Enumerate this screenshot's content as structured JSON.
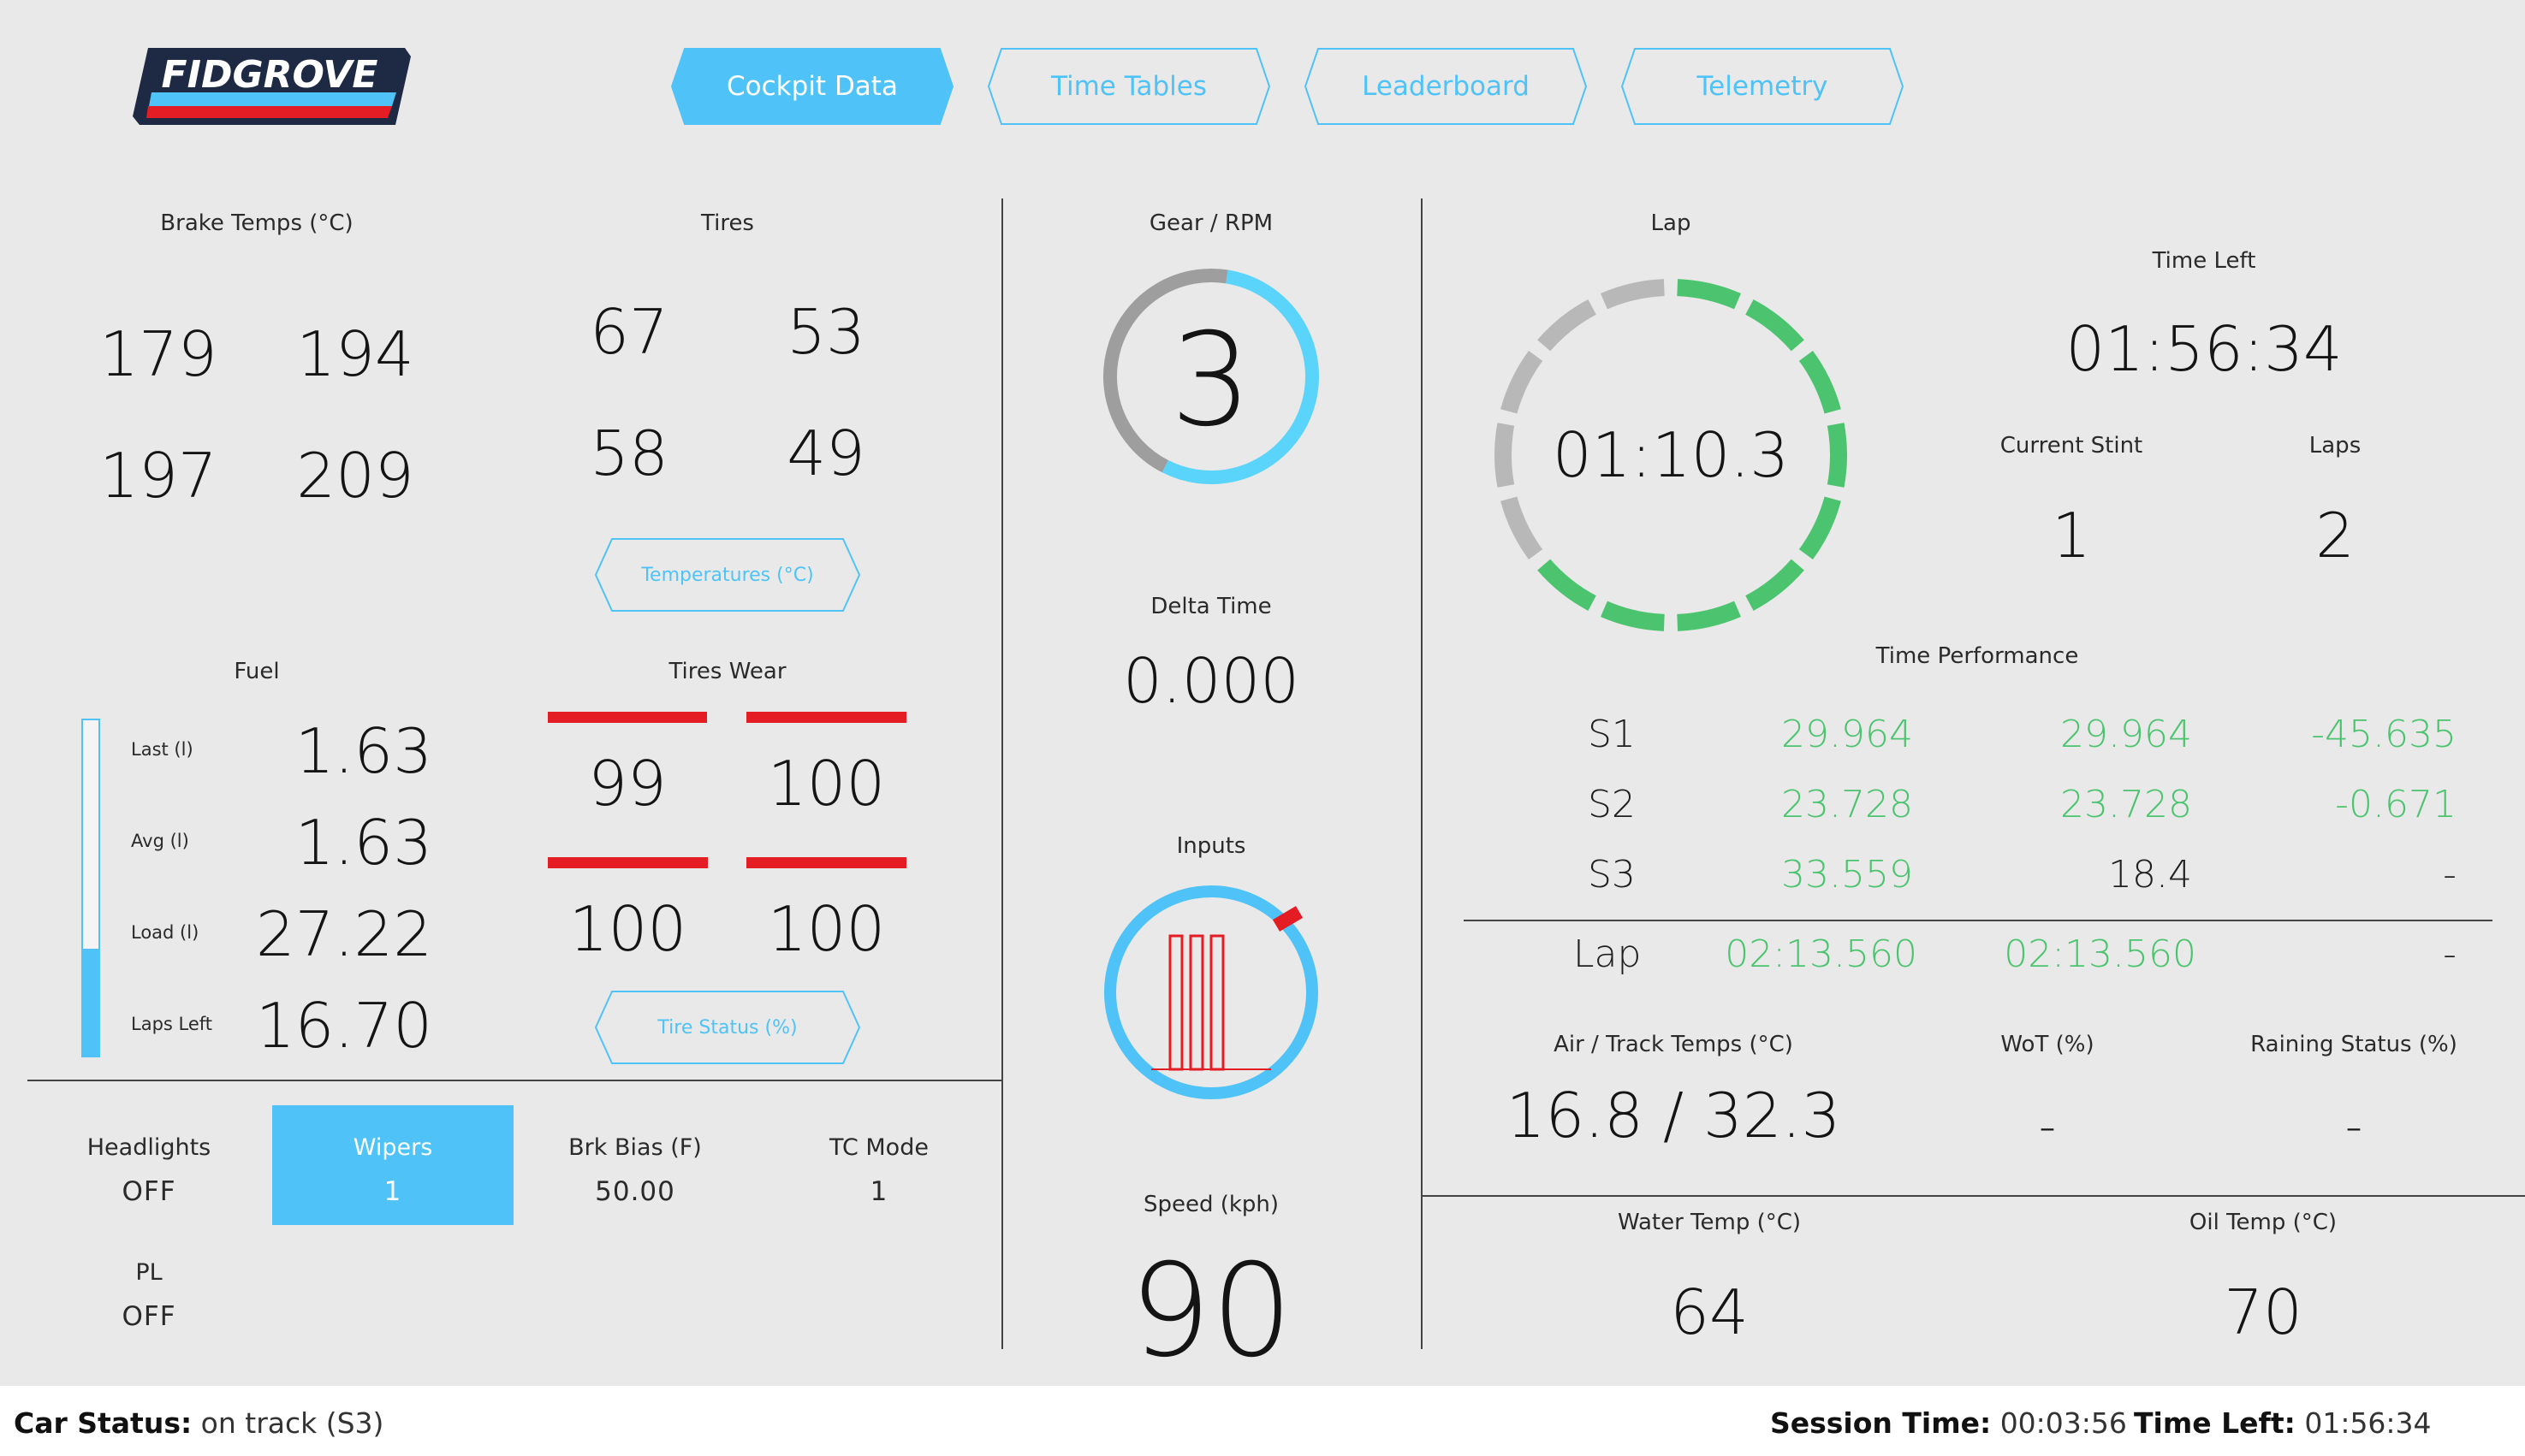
{
  "brand": {
    "name": "FIDGROVE"
  },
  "tabs": [
    {
      "label": "Cockpit Data",
      "active": true
    },
    {
      "label": "Time Tables",
      "active": false
    },
    {
      "label": "Leaderboard",
      "active": false
    },
    {
      "label": "Telemetry",
      "active": false
    }
  ],
  "brake_temps": {
    "title": "Brake Temps (°C)",
    "fl": "179",
    "fr": "194",
    "rl": "197",
    "rr": "209"
  },
  "tires": {
    "title": "Tires",
    "fl": "67",
    "fr": "53",
    "rl": "58",
    "rr": "49",
    "button_label": "Temperatures (°C)"
  },
  "fuel": {
    "title": "Fuel",
    "last_label": "Last (l)",
    "last_value": "1.63",
    "avg_label": "Avg (l)",
    "avg_value": "1.63",
    "load_label": "Load (l)",
    "load_value": "27.22",
    "laps_left_label": "Laps Left",
    "laps_left_value": "16.70",
    "gauge_fill_fraction": 0.32
  },
  "tires_wear": {
    "title": "Tires Wear",
    "fl": "99",
    "fr": "100",
    "rl": "100",
    "rr": "100",
    "button_label": "Tire Status (%)"
  },
  "controls": {
    "headlights": {
      "label": "Headlights",
      "value": "OFF"
    },
    "wipers": {
      "label": "Wipers",
      "value": "1",
      "active": true
    },
    "brake_bias": {
      "label": "Brk Bias (F)",
      "value": "50.00"
    },
    "tc_mode": {
      "label": "TC Mode",
      "value": "1"
    },
    "pl": {
      "label": "PL",
      "value": "OFF"
    }
  },
  "gear": {
    "title": "Gear / RPM",
    "value": "3",
    "rpm_fraction": 0.55
  },
  "delta": {
    "title": "Delta Time",
    "value": "0.000"
  },
  "inputs": {
    "title": "Inputs"
  },
  "speed": {
    "title": "Speed (kph)",
    "value": "90"
  },
  "lap": {
    "title": "Lap",
    "time": "01:10.3",
    "green_segments": 9,
    "total_segments": 14
  },
  "time_left": {
    "title": "Time Left",
    "value": "01:56:34"
  },
  "current_stint": {
    "title": "Current Stint",
    "value": "1"
  },
  "laps": {
    "title": "Laps",
    "value": "2"
  },
  "performance": {
    "title": "Time Performance",
    "rows": [
      {
        "label": "S1",
        "a": "29.964",
        "b": "29.964",
        "c": "-45.635"
      },
      {
        "label": "S2",
        "a": "23.728",
        "b": "23.728",
        "c": "-0.671"
      },
      {
        "label": "S3",
        "a": "33.559",
        "b": "18.4",
        "c": "-"
      }
    ],
    "lap": {
      "label": "Lap",
      "a": "02:13.560",
      "b": "02:13.560",
      "c": "-"
    }
  },
  "air_track": {
    "title": "Air / Track Temps (°C)",
    "value": "16.8 / 32.3"
  },
  "wot": {
    "title": "WoT (%)",
    "value": "-"
  },
  "raining": {
    "title": "Raining Status (%)",
    "value": "-"
  },
  "water_temp": {
    "title": "Water Temp (°C)",
    "value": "64"
  },
  "oil_temp": {
    "title": "Oil Temp (°C)",
    "value": "70"
  },
  "footer": {
    "car_status_label": "Car Status:",
    "car_status_value": "on track (S3)",
    "session_time_label": "Session Time:",
    "session_time_value": "00:03:56",
    "time_left_label": "Time Left:",
    "time_left_value": "01:56:34"
  },
  "colors": {
    "accent": "#4fc3f7",
    "green": "#4cc46f",
    "red": "#e41c23",
    "grey": "#b8b8b8"
  }
}
